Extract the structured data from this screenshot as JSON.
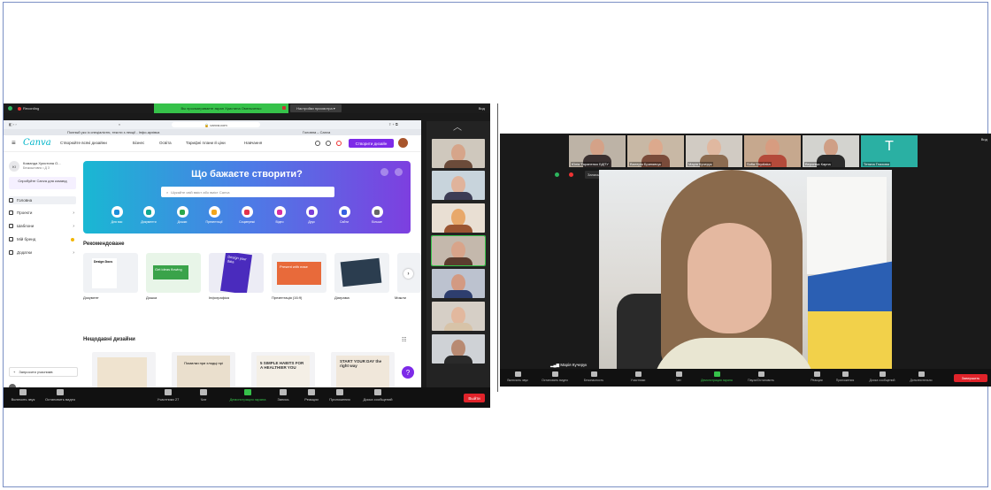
{
  "left_window": {
    "recording": "Recording",
    "share_banner": "Вы просматриваете экран Христина Омельченко",
    "view_options": "Настройки просмотра",
    "view": "Вид",
    "browser": {
      "url": "canva.com",
      "tab1": "Полный укс із спеціалістю, тексти з лекції - Інфо-архівка",
      "tab2": "Головна – Canva"
    },
    "canva": {
      "logo": "Canva",
      "nav": [
        "Створюйте всякі дизайни",
        "Бізнес",
        "Освіта",
        "Тарифні плани й ціни",
        "Навчання"
      ],
      "create_button": "Створити дизайн",
      "team_badge": "КІ",
      "team_name": "Команда Христина О...",
      "team_sub": "Безкоштовно • Д З",
      "try_pro": "Спробуйте Canva для команд",
      "sidebar": [
        {
          "label": "Головна",
          "active": true
        },
        {
          "label": "Проекти"
        },
        {
          "label": "Шаблони"
        },
        {
          "label": "Мій бренд"
        },
        {
          "label": "Додатки"
        }
      ],
      "invite": "Запросити учасників",
      "trash": "Кошик",
      "hero_title": "Що бажаєте створити?",
      "hero_search_placeholder": "Шукайте свій вміст або вміст Canva",
      "hero_categories": [
        "Для вас",
        "Документи",
        "Дошки",
        "Презентації",
        "Соцмережі",
        "Відео",
        "Друк",
        "Сайти",
        "Більше"
      ],
      "recommended_title": "Рекомендоване",
      "recommended": [
        "Документ",
        "Дошка",
        "Інфографіка",
        "Презентація (16:9)",
        "Діаграма",
        "Можли"
      ],
      "rec_card_texts": [
        "Design Docs",
        "Get ideas flowing",
        "Design your data",
        "Present with ease",
        "",
        ""
      ],
      "recent_title": "Нещодавні дизайни",
      "recent_card_texts": [
        "",
        "Помилки при хлодці прі",
        "5 SIMPLE HABITS FOR A HEALTHIER YOU",
        "START YOUR DAY the right way"
      ]
    },
    "thumbnails": 7,
    "toolbar": [
      {
        "label": "Включить звук"
      },
      {
        "label": "Остановить видео"
      },
      {
        "label": "Участники",
        "count": "27"
      },
      {
        "label": "Чат"
      },
      {
        "label": "Демонстрация экрана",
        "green": true
      },
      {
        "label": "Запись"
      },
      {
        "label": "Реакции"
      },
      {
        "label": "Приложения"
      },
      {
        "label": "Доска сообщений"
      }
    ],
    "leave": "Выйти"
  },
  "right_window": {
    "view": "Вид",
    "strip": [
      {
        "name": "Юлія Тараненко БДПУ"
      },
      {
        "name": "Валерія Бринявчук"
      },
      {
        "name": "Марія Кучерук"
      },
      {
        "name": "Sofia Shydlaka"
      },
      {
        "name": "Вероніка Карпа"
      },
      {
        "name": "Тетяна Глахова",
        "initial": "T"
      }
    ],
    "top_pill": "Запись...",
    "speaker_name": "Марія Кучерук",
    "toolbar": [
      "Включить звук",
      "Остановить видео",
      "Безопасность",
      "Участники",
      "Чат",
      "Демонстрация экрана",
      "Пауза/Остановить",
      "Реакции",
      "Приложения",
      "Доска сообщений",
      "Дополнительно"
    ],
    "end": "Завершить"
  }
}
